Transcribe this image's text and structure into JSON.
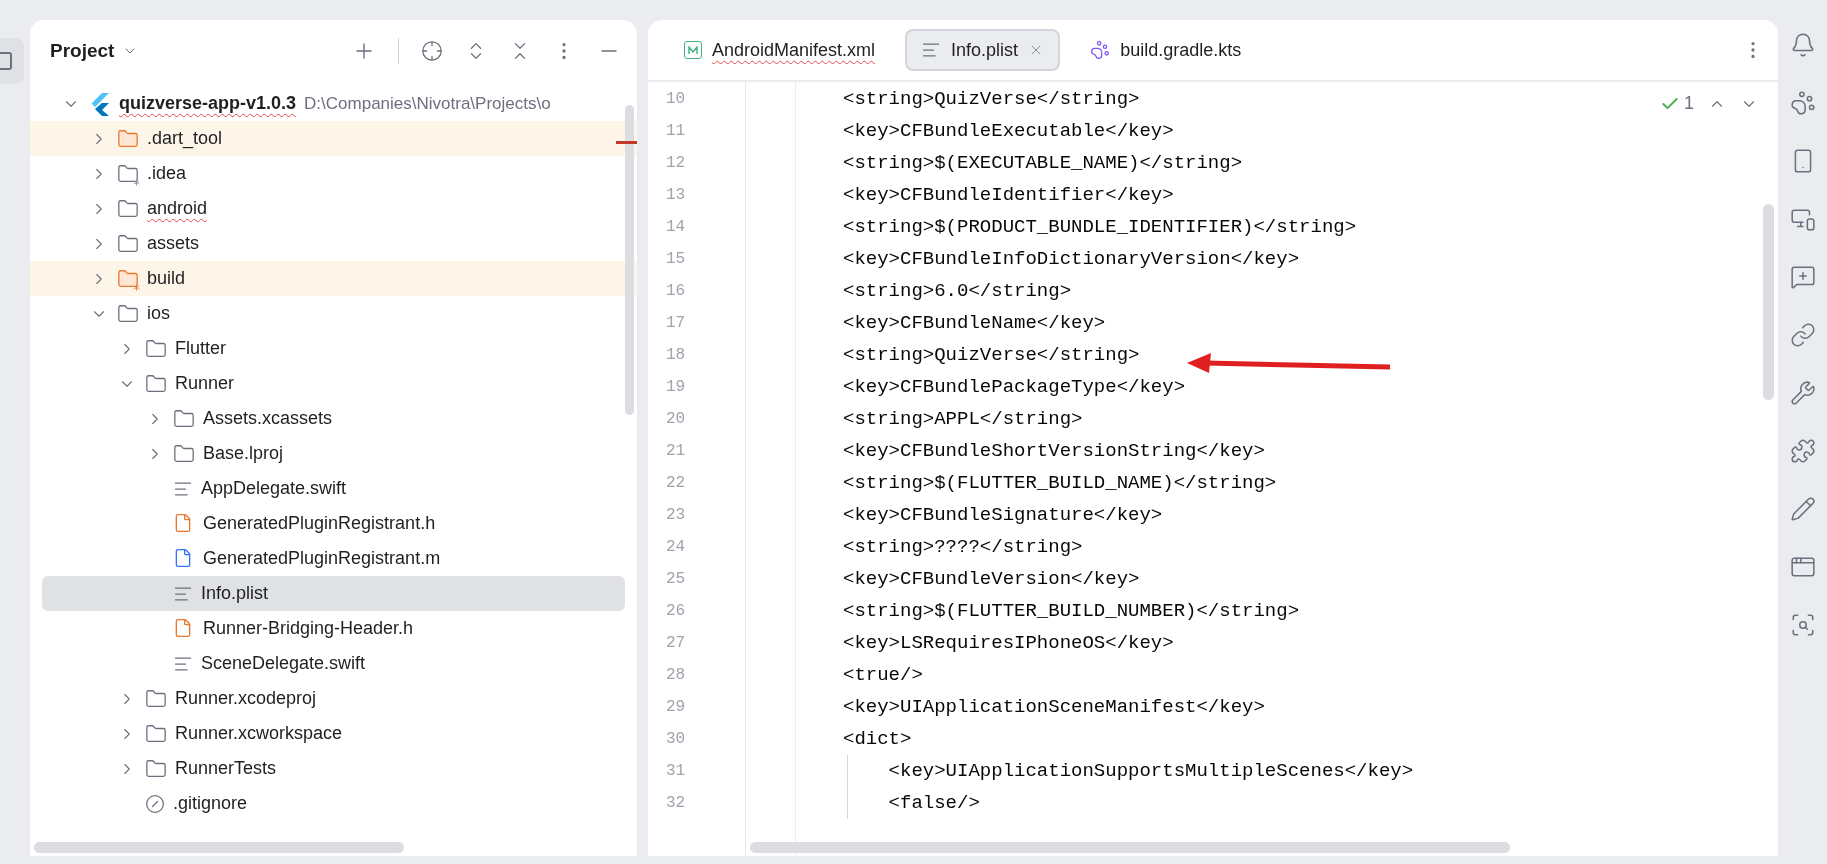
{
  "project_panel": {
    "title": "Project",
    "tree": [
      {
        "label": "quizverse-app-v1.0.3",
        "path": "D:\\Companies\\Nivotra\\Projects\\o",
        "kind": "flutter",
        "expanded": true,
        "selected": false,
        "excluded": false,
        "misspelled": true,
        "children": [
          {
            "label": ".dart_tool",
            "kind": "folder",
            "expanded": false,
            "selected": false,
            "excluded": true,
            "misspelled": false
          },
          {
            "label": ".idea",
            "kind": "config-folder",
            "expanded": false,
            "selected": false,
            "excluded": false,
            "misspelled": false
          },
          {
            "label": "android",
            "kind": "folder",
            "expanded": false,
            "selected": false,
            "excluded": false,
            "misspelled": true
          },
          {
            "label": "assets",
            "kind": "folder",
            "expanded": false,
            "selected": false,
            "excluded": false,
            "misspelled": false
          },
          {
            "label": "build",
            "kind": "config-folder",
            "expanded": false,
            "selected": false,
            "excluded": true,
            "misspelled": false
          },
          {
            "label": "ios",
            "kind": "folder",
            "expanded": true,
            "selected": false,
            "excluded": false,
            "misspelled": false,
            "children": [
              {
                "label": "Flutter",
                "kind": "folder",
                "expanded": false,
                "selected": false,
                "excluded": false,
                "misspelled": false
              },
              {
                "label": "Runner",
                "kind": "folder",
                "expanded": true,
                "selected": false,
                "excluded": false,
                "misspelled": false,
                "children": [
                  {
                    "label": "Assets.xcassets",
                    "kind": "folder",
                    "expanded": false,
                    "selected": false,
                    "excluded": false,
                    "misspelled": false
                  },
                  {
                    "label": "Base.lproj",
                    "kind": "folder",
                    "expanded": false,
                    "selected": false,
                    "excluded": false,
                    "misspelled": false
                  },
                  {
                    "label": "AppDelegate.swift",
                    "kind": "text",
                    "selected": false,
                    "excluded": false,
                    "misspelled": false
                  },
                  {
                    "label": "GeneratedPluginRegistrant.h",
                    "kind": "header",
                    "selected": false,
                    "excluded": false,
                    "misspelled": false
                  },
                  {
                    "label": "GeneratedPluginRegistrant.m",
                    "kind": "source",
                    "selected": false,
                    "excluded": false,
                    "misspelled": false
                  },
                  {
                    "label": "Info.plist",
                    "kind": "text",
                    "selected": true,
                    "excluded": false,
                    "misspelled": false
                  },
                  {
                    "label": "Runner-Bridging-Header.h",
                    "kind": "header",
                    "selected": false,
                    "excluded": false,
                    "misspelled": false
                  },
                  {
                    "label": "SceneDelegate.swift",
                    "kind": "text",
                    "selected": false,
                    "excluded": false,
                    "misspelled": false
                  }
                ]
              },
              {
                "label": "Runner.xcodeproj",
                "kind": "folder",
                "expanded": false,
                "selected": false,
                "excluded": false,
                "misspelled": false
              },
              {
                "label": "Runner.xcworkspace",
                "kind": "folder",
                "expanded": false,
                "selected": false,
                "excluded": false,
                "misspelled": false
              },
              {
                "label": "RunnerTests",
                "kind": "folder",
                "expanded": false,
                "selected": false,
                "excluded": false,
                "misspelled": false
              },
              {
                "label": ".gitignore",
                "kind": "ignore",
                "selected": false,
                "excluded": false,
                "misspelled": false
              }
            ]
          }
        ]
      }
    ]
  },
  "editor": {
    "tabs": [
      {
        "label": "AndroidManifest.xml",
        "kind": "manifest",
        "selected": false,
        "misspelled": true
      },
      {
        "label": "Info.plist",
        "kind": "text",
        "selected": true,
        "misspelled": false
      },
      {
        "label": "build.gradle.kts",
        "kind": "gradle",
        "selected": false,
        "misspelled": false
      }
    ],
    "inspection_count": "1",
    "lines": [
      {
        "number": "10",
        "text": "<string>QuizVerse</string>"
      },
      {
        "number": "11",
        "text": "<key>CFBundleExecutable</key>"
      },
      {
        "number": "12",
        "text": "<string>$(EXECUTABLE_NAME)</string>"
      },
      {
        "number": "13",
        "text": "<key>CFBundleIdentifier</key>"
      },
      {
        "number": "14",
        "text": "<string>$(PRODUCT_BUNDLE_IDENTIFIER)</string>"
      },
      {
        "number": "15",
        "text": "<key>CFBundleInfoDictionaryVersion</key>"
      },
      {
        "number": "16",
        "text": "<string>6.0</string>"
      },
      {
        "number": "17",
        "text": "<key>CFBundleName</key>"
      },
      {
        "number": "18",
        "text": "<string>QuizVerse</string>"
      },
      {
        "number": "19",
        "text": "<key>CFBundlePackageType</key>"
      },
      {
        "number": "20",
        "text": "<string>APPL</string>"
      },
      {
        "number": "21",
        "text": "<key>CFBundleShortVersionString</key>"
      },
      {
        "number": "22",
        "text": "<string>$(FLUTTER_BUILD_NAME)</string>"
      },
      {
        "number": "23",
        "text": "<key>CFBundleSignature</key>"
      },
      {
        "number": "24",
        "text": "<string>????</string>"
      },
      {
        "number": "25",
        "text": "<key>CFBundleVersion</key>"
      },
      {
        "number": "26",
        "text": "<string>$(FLUTTER_BUILD_NUMBER)</string>"
      },
      {
        "number": "27",
        "text": "<key>LSRequiresIPhoneOS</key>"
      },
      {
        "number": "28",
        "text": "<true/>"
      },
      {
        "number": "29",
        "text": "<key>UIApplicationSceneManifest</key>"
      },
      {
        "number": "30",
        "text": "<dict>"
      },
      {
        "number": "31",
        "text": "    <key>UIApplicationSupportsMultipleScenes</key>"
      },
      {
        "number": "32",
        "text": "    <false/>"
      }
    ]
  }
}
